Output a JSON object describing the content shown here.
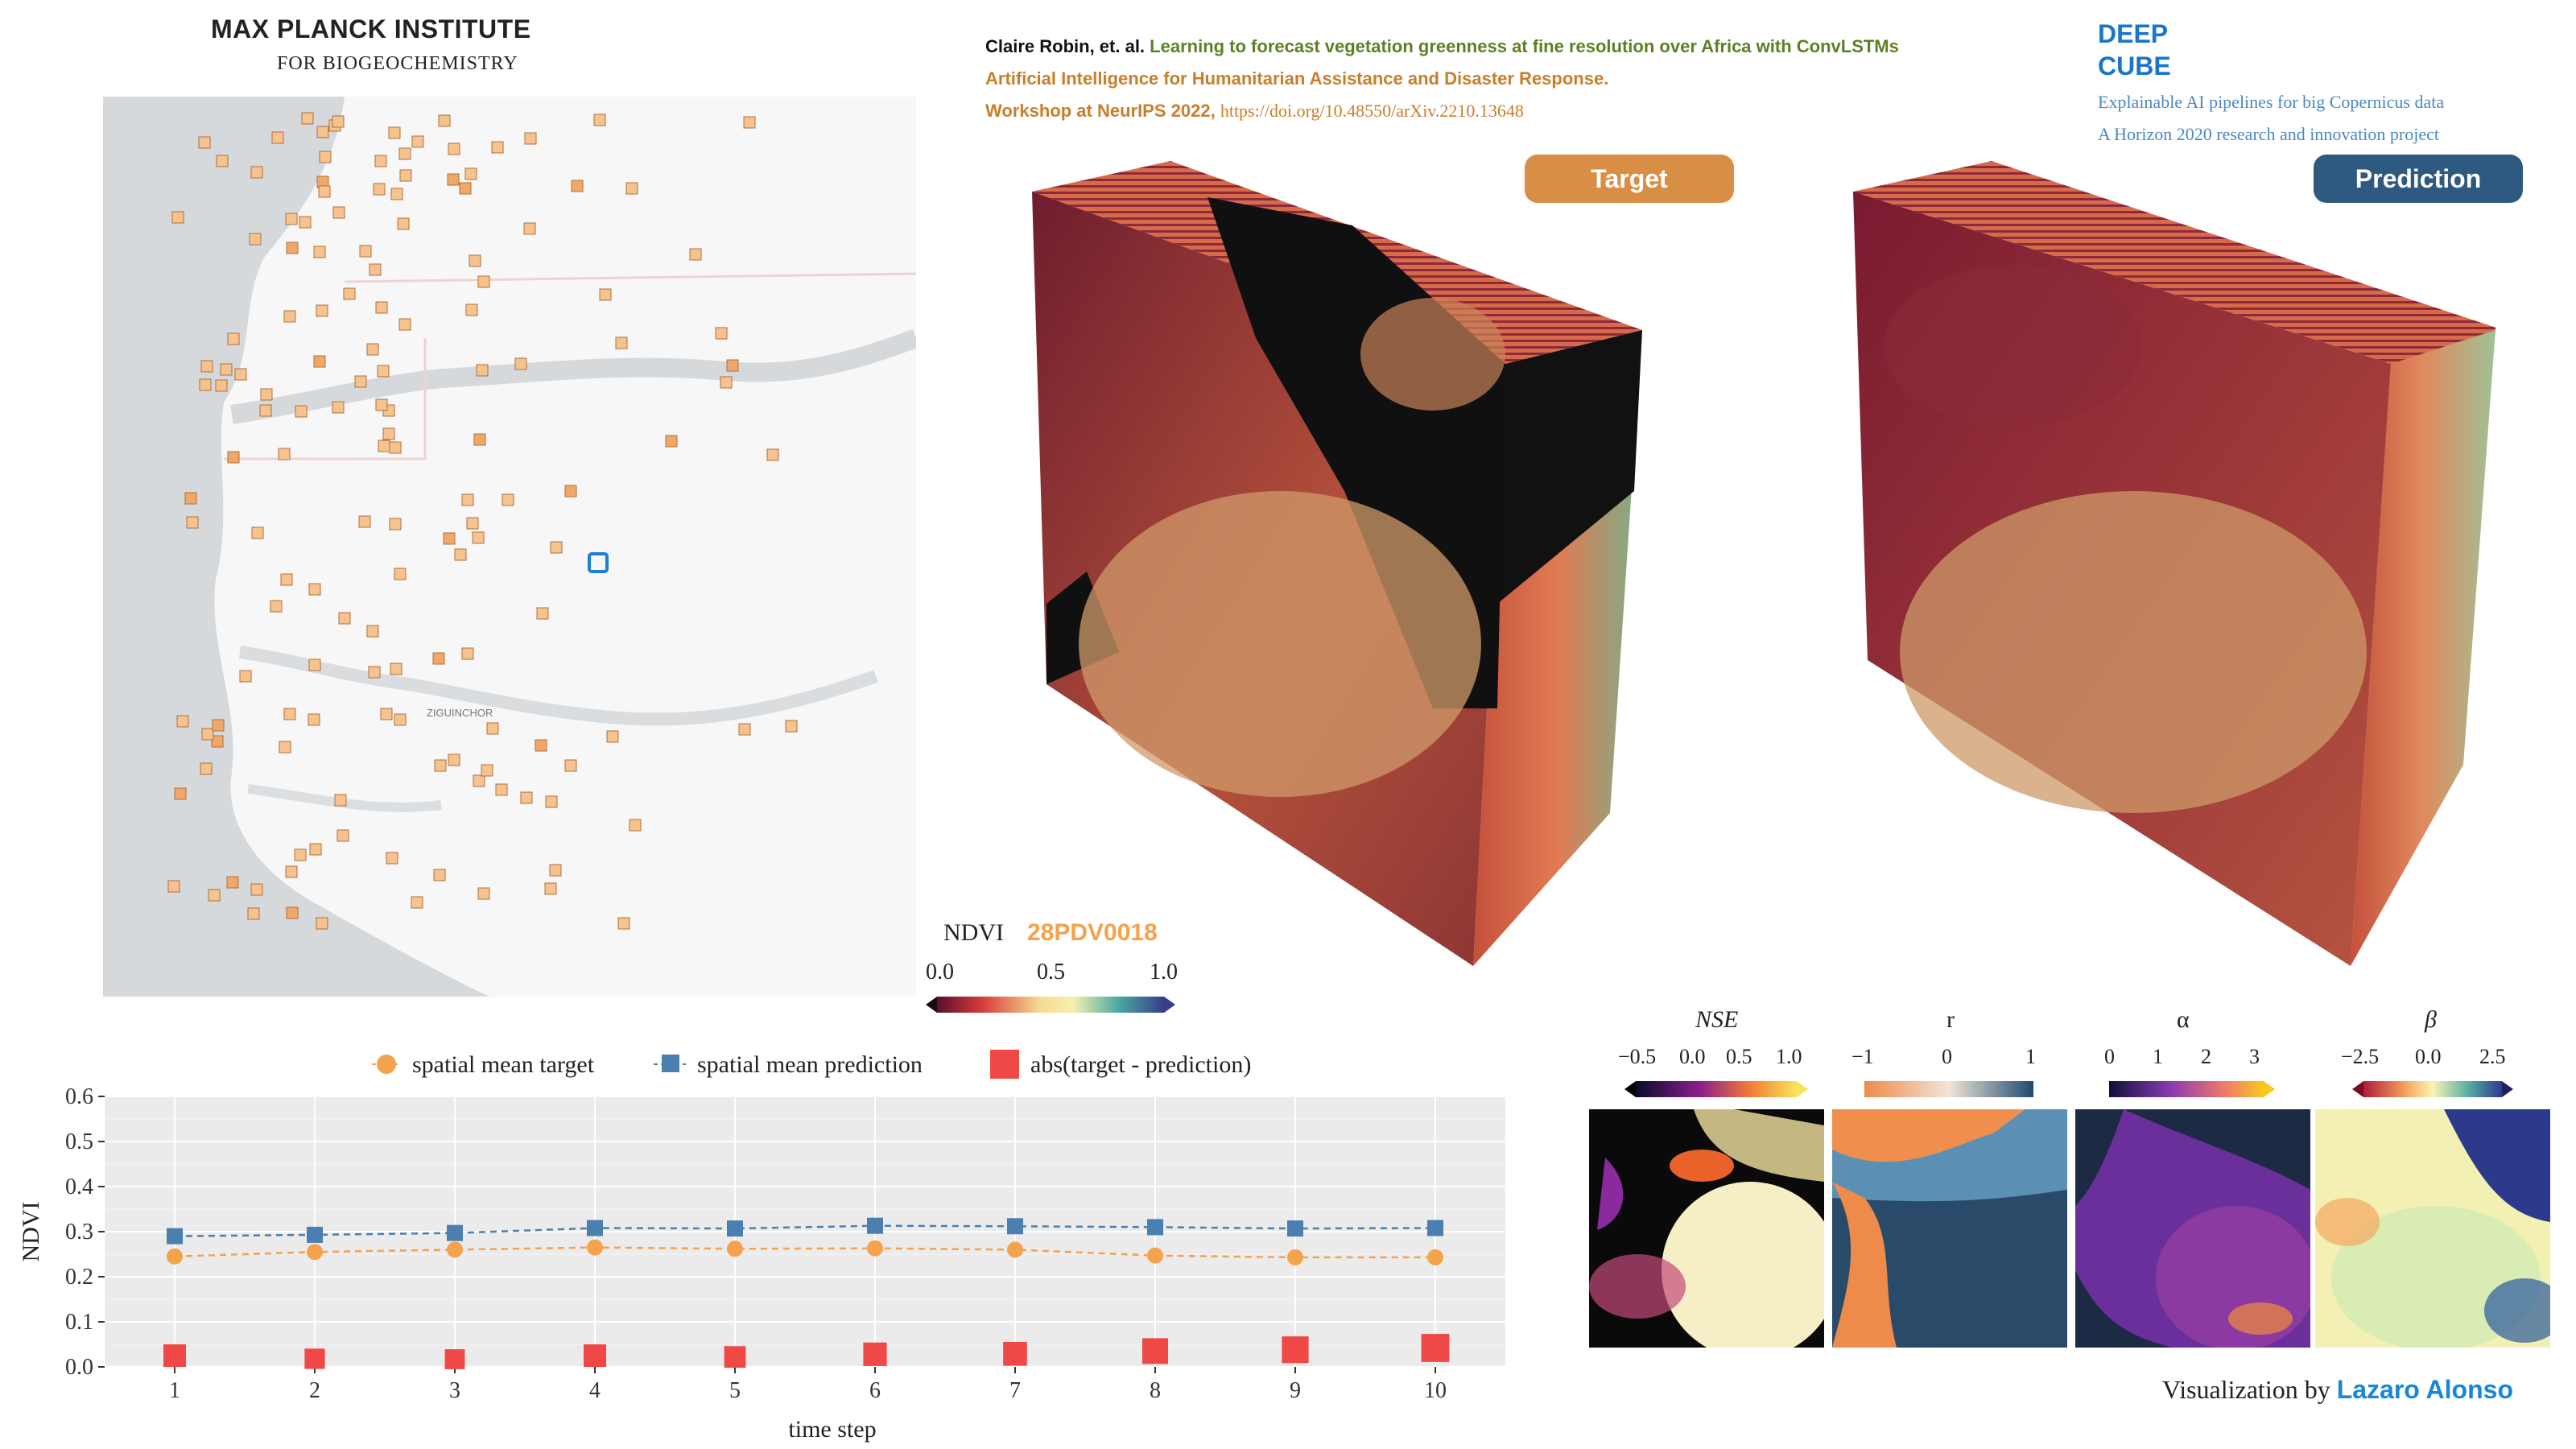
{
  "header": {
    "institute": "MAX PLANCK INSTITUTE",
    "institute_sub": "FOR BIOGEOCHEMISTRY",
    "authors": "Claire Robin, et. al.",
    "paper_title": "Learning to forecast vegetation greenness at fine resolution over Africa with ConvLSTMs",
    "workshop": "Artificial Intelligence for Humanitarian Assistance and Disaster Response.",
    "venue": "Workshop at NeurIPS 2022,",
    "doi": "https://doi.org/10.48550/arXiv.2210.13648",
    "project_name_1": "DEEP",
    "project_name_2": "CUBE",
    "project_desc_1": "Explainable AI pipelines for big Copernicus data",
    "project_desc_2": "A Horizon 2020 research and innovation project"
  },
  "cubes": {
    "target_label": "Target",
    "prediction_label": "Prediction"
  },
  "map": {
    "labels": [
      "ZIGUINCHOR"
    ],
    "selected_tile_color": "#1e7fd8",
    "tile_color": "#f6c28e"
  },
  "ndvi_colorbar": {
    "label": "NDVI",
    "tile_id": "28PDV0018",
    "ticks": [
      "0.0",
      "0.5",
      "1.0"
    ]
  },
  "metrics": {
    "nse": {
      "label": "NSE",
      "ticks": [
        "−0.5",
        "0.0",
        "0.5",
        "1.0"
      ]
    },
    "r": {
      "label": "r",
      "ticks": [
        "−1",
        "0",
        "1"
      ]
    },
    "alpha": {
      "label": "α",
      "ticks": [
        "0",
        "1",
        "2",
        "3"
      ]
    },
    "beta": {
      "label": "β",
      "ticks": [
        "−2.5",
        "0.0",
        "2.5"
      ]
    }
  },
  "credit": {
    "prefix": "Visualization by",
    "name": "Lazaro Alonso"
  },
  "chart_data": {
    "type": "line",
    "xlabel": "time step",
    "ylabel": "NDVI",
    "ylim": [
      0.0,
      0.6
    ],
    "yticks": [
      "0.0",
      "0.1",
      "0.2",
      "0.3",
      "0.4",
      "0.5",
      "0.6"
    ],
    "x": [
      1,
      2,
      3,
      4,
      5,
      6,
      7,
      8,
      9,
      10
    ],
    "grid": true,
    "legend_position": "top",
    "series": [
      {
        "name": "spatial mean target",
        "color": "#f4a24c",
        "marker": "circle",
        "values": [
          0.245,
          0.255,
          0.26,
          0.265,
          0.262,
          0.263,
          0.26,
          0.247,
          0.243,
          0.243
        ]
      },
      {
        "name": "spatial mean prediction",
        "color": "#4a7fb0",
        "marker": "square",
        "values": [
          0.29,
          0.293,
          0.297,
          0.308,
          0.307,
          0.313,
          0.312,
          0.31,
          0.307,
          0.308
        ]
      },
      {
        "name": "abs(target - prediction)",
        "color": "#f04747",
        "marker": "square-large",
        "values": [
          0.025,
          0.018,
          0.017,
          0.025,
          0.022,
          0.028,
          0.029,
          0.035,
          0.038,
          0.042
        ]
      }
    ]
  }
}
